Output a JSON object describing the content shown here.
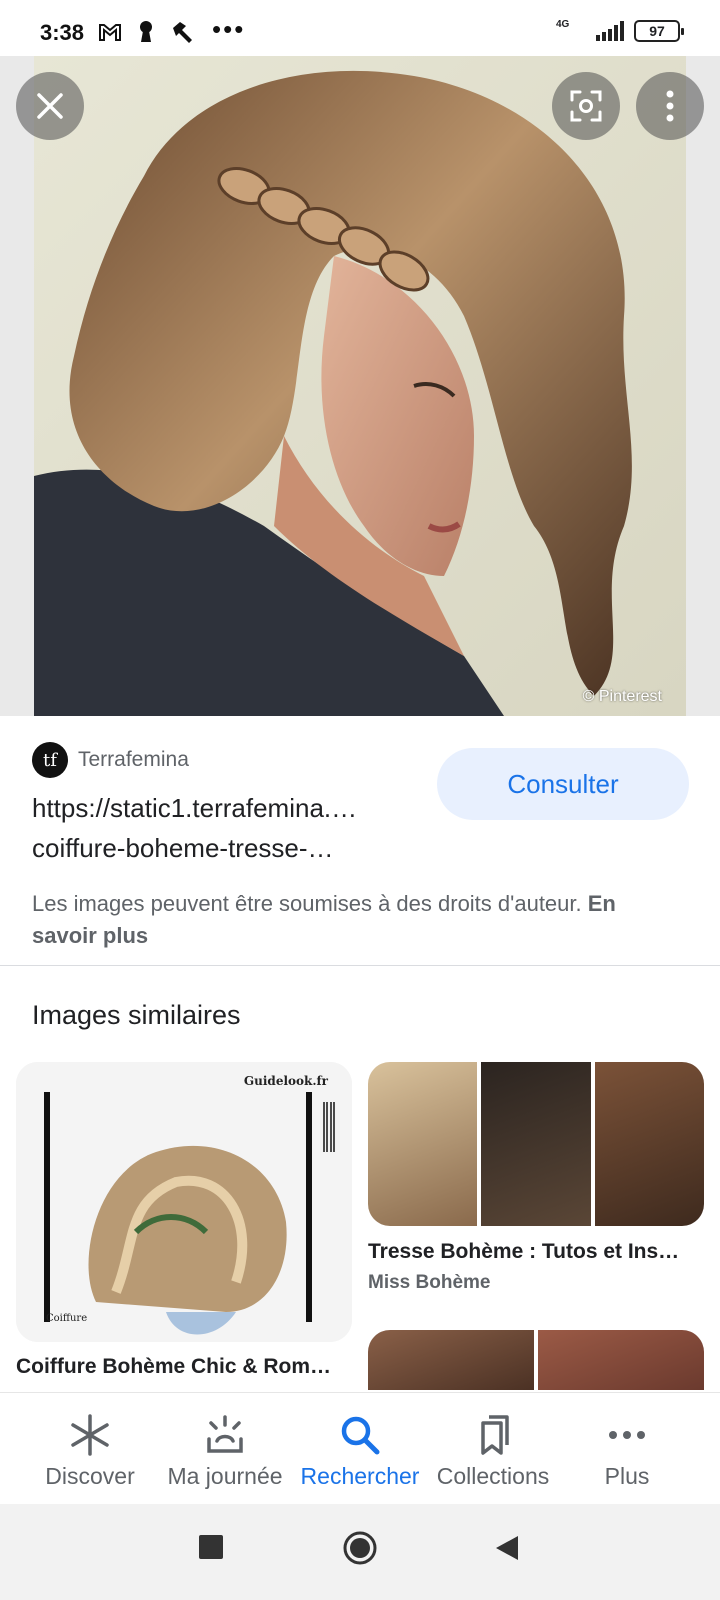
{
  "status_bar": {
    "time": "3:38",
    "network": "4G",
    "battery": "97",
    "icons": [
      "gmail-icon",
      "keyhole-icon",
      "hammer-icon",
      "more-dots-icon",
      "signal-icon",
      "battery-icon"
    ]
  },
  "hero": {
    "credit": "© Pinterest",
    "buttons": [
      "close-icon",
      "lens-icon",
      "more-vertical-icon"
    ]
  },
  "source": {
    "logo_text": "tf",
    "name": "Terrafemina",
    "url": "https://static1.terrafemina.… coiffure-boheme-tresse-…",
    "url_line1": "https://static1.terrafemina.…",
    "url_line2": "coiffure-boheme-tresse-…",
    "consult_label": "Consulter",
    "rights_text": "Les images peuvent être soumises à des droits d'auteur.",
    "rights_link": "En savoir plus"
  },
  "similar": {
    "title": "Images similaires",
    "items": [
      {
        "title": "Coiffure Bohème Chic & Rom…",
        "source": "Guidelook",
        "watermark": "Guidelook.fr",
        "caption": "Coiffure"
      },
      {
        "title": "Tresse Bohème : Tutos et Ins…",
        "source": "Miss Bohème"
      }
    ]
  },
  "bottom_nav": {
    "items": [
      {
        "label": "Discover",
        "icon": "asterisk-icon"
      },
      {
        "label": "Ma journée",
        "icon": "sunrise-icon"
      },
      {
        "label": "Rechercher",
        "icon": "search-icon"
      },
      {
        "label": "Collections",
        "icon": "bookmarks-icon"
      },
      {
        "label": "Plus",
        "icon": "more-horizontal-icon"
      }
    ],
    "active": "Rechercher"
  },
  "colors": {
    "accent": "#1a73e8",
    "button_bg": "#e8f0fe",
    "text_primary": "#202124",
    "text_secondary": "#5f6368"
  }
}
